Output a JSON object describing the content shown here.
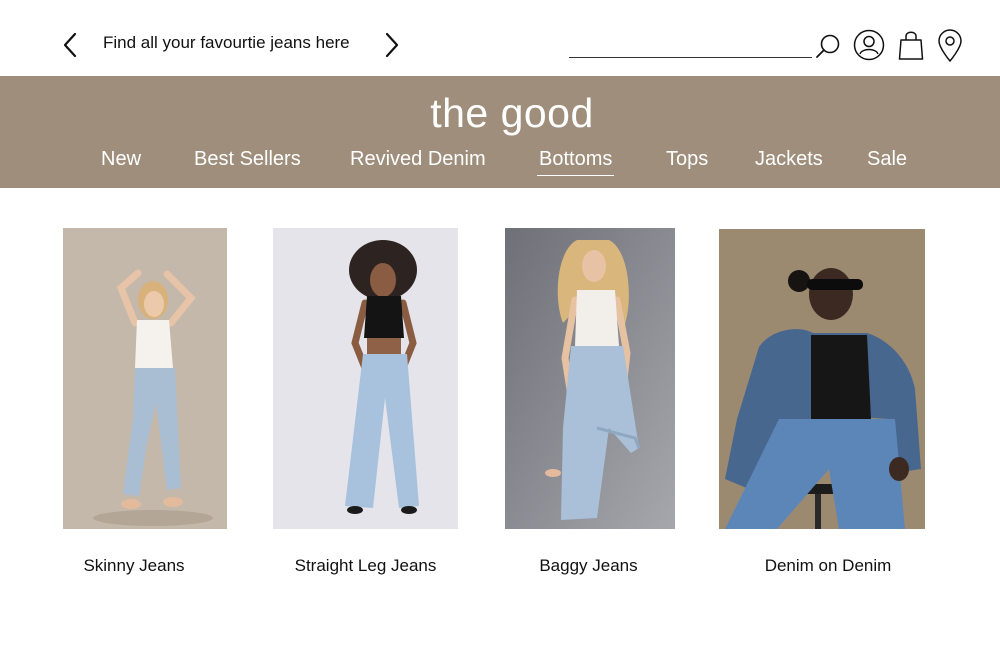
{
  "topbar": {
    "prev_icon": "chevron-left-icon",
    "promo_text": "Find all your favourtie jeans here",
    "next_icon": "chevron-right-icon",
    "search": {
      "value": "",
      "placeholder": "",
      "icon": "search-icon"
    },
    "icons": [
      "account-icon",
      "shopping-bag-icon",
      "location-pin-icon"
    ]
  },
  "brand": {
    "name": "the good",
    "background": "#9e8e7b"
  },
  "nav": {
    "items": [
      {
        "label": "New"
      },
      {
        "label": "Best Sellers"
      },
      {
        "label": "Revived Denim"
      },
      {
        "label": "Bottoms"
      },
      {
        "label": "Tops"
      },
      {
        "label": "Jackets"
      },
      {
        "label": "Sale"
      }
    ],
    "active": "Bottoms"
  },
  "products": [
    {
      "label": "Skinny Jeans",
      "background": "#c4b8aa"
    },
    {
      "label": "Straight Leg Jeans",
      "background": "#e4e4ea"
    },
    {
      "label": "Baggy Jeans",
      "background": "#8e8f96"
    },
    {
      "label": "Denim on Denim",
      "background": "#9c8a70"
    }
  ]
}
